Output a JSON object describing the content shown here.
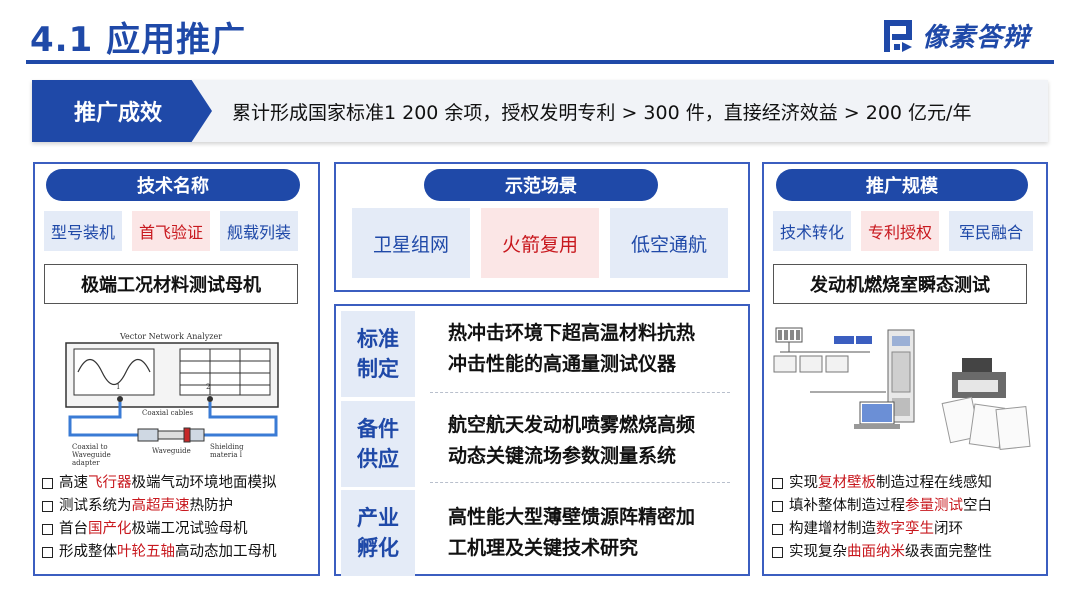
{
  "header": {
    "title": "4.1  应用推广",
    "logo_text": "像素答辩",
    "brand_color": "#1f49a8"
  },
  "banner": {
    "label": "推广成效",
    "text": "累计形成国家标准1 200 余项，授权发明专利 > 300 件，直接经济效益 > 200 亿元/年"
  },
  "left_panel": {
    "header": "技术名称",
    "tags": [
      {
        "label": "型号装机",
        "highlight": false
      },
      {
        "label": "首飞验证",
        "highlight": true
      },
      {
        "label": "舰载列装",
        "highlight": false
      }
    ],
    "device_title": "极端工况材料测试母机",
    "figure": {
      "title": "Vector Network Analyzer",
      "port_1": "1",
      "port_2": "2",
      "coaxial_cables": "Coaxial cables",
      "coaxial_to_waveguide": "Coaxial to",
      "waveguide_adapter_1": "Waveguide",
      "waveguide_adapter_2": "adapter",
      "waveguide": "Waveguide",
      "shielding_1": "Shielding",
      "shielding_2": "materia l"
    },
    "bullets": [
      {
        "before": "高速",
        "highlight": "飞行器",
        "after": "极端气动环境地面模拟"
      },
      {
        "before": "测试系统为",
        "highlight": "高超声速",
        "after": "热防护"
      },
      {
        "before": "首台",
        "highlight": "国产化",
        "after": "极端工况试验母机"
      },
      {
        "before": "形成整体",
        "highlight": "叶轮五轴",
        "after": "高动态加工母机"
      }
    ]
  },
  "middle_panel": {
    "header": "示范场景",
    "scenes": [
      {
        "label": "卫星组网",
        "highlight": false
      },
      {
        "label": "火箭复用",
        "highlight": true
      },
      {
        "label": "低空通航",
        "highlight": false
      }
    ],
    "rows": [
      {
        "label_1": "标准",
        "label_2": "制定",
        "line_1": "热冲击环境下超高温材料抗热",
        "line_2": "冲击性能的高通量测试仪器"
      },
      {
        "label_1": "备件",
        "label_2": "供应",
        "line_1": "航空航天发动机喷雾燃烧高频",
        "line_2": "动态关键流场参数测量系统"
      },
      {
        "label_1": "产业",
        "label_2": "孵化",
        "line_1": "高性能大型薄壁馈源阵精密加",
        "line_2": "工机理及关键技术研究"
      }
    ]
  },
  "right_panel": {
    "header": "推广规模",
    "tags": [
      {
        "label": "技术转化",
        "highlight": false
      },
      {
        "label": "专利授权",
        "highlight": true
      },
      {
        "label": "军民融合",
        "highlight": false
      }
    ],
    "device_title": "发动机燃烧室瞬态测试",
    "bullets": [
      {
        "before": "实现",
        "highlight": "复材壁板",
        "after": "制造过程在线感知"
      },
      {
        "before": "填补整体制造过程",
        "highlight": "参量测试",
        "after": "空白"
      },
      {
        "before": "构建增材制造",
        "highlight": "数字孪生",
        "after": "闭环"
      },
      {
        "before": "实现复杂",
        "highlight": "曲面纳米",
        "after": "级表面完整性"
      }
    ]
  }
}
